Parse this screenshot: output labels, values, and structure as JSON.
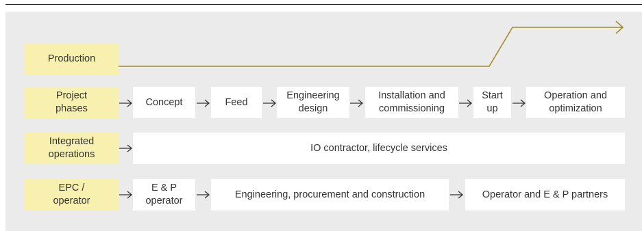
{
  "colors": {
    "background": "#ebebeb",
    "label_fill": "#f7f0ae",
    "box_fill": "#ffffff",
    "production_line": "#a08a2a",
    "arrow": "#333333"
  },
  "production": {
    "label": "Production"
  },
  "rows": {
    "project_phases": {
      "label": "Project\nphases",
      "steps": [
        "Concept",
        "Feed",
        "Engineering\ndesign",
        "Installation and\ncommissioning",
        "Start\nup",
        "Operation and\noptimization"
      ]
    },
    "integrated_operations": {
      "label": "Integrated\noperations",
      "steps": [
        "IO contractor, lifecycle services"
      ]
    },
    "epc_operator": {
      "label": "EPC /\noperator",
      "steps": [
        "E & P\noperator",
        "Engineering, procurement and construction",
        "Operator and E & P partners"
      ]
    }
  }
}
